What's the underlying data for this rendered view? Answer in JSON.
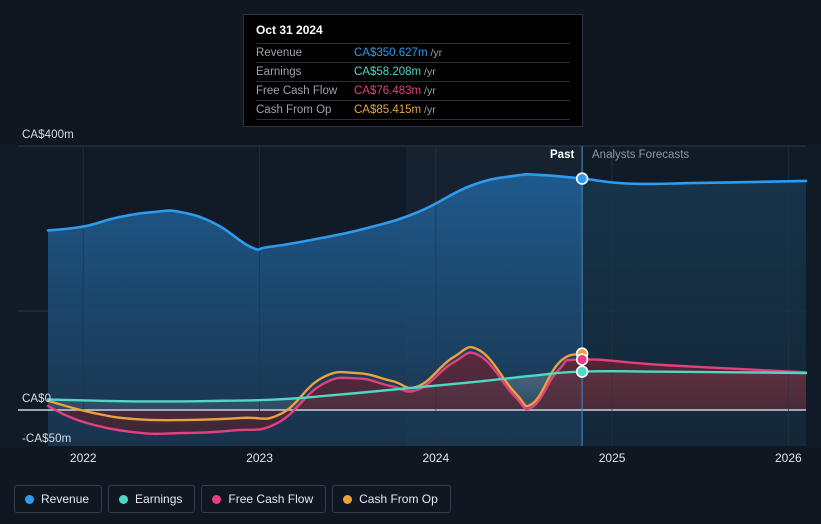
{
  "tooltip": {
    "title": "Oct 31 2024",
    "rows": [
      {
        "name": "Revenue",
        "value": "CA$350.627m",
        "unit": "/yr",
        "color": "#2e9bef"
      },
      {
        "name": "Earnings",
        "value": "CA$58.208m",
        "unit": "/yr",
        "color": "#4fd8c2"
      },
      {
        "name": "Free Cash Flow",
        "value": "CA$76.483m",
        "unit": "/yr",
        "color": "#e4407f"
      },
      {
        "name": "Cash From Op",
        "value": "CA$85.415m",
        "unit": "/yr",
        "color": "#e8a33d"
      }
    ]
  },
  "period": {
    "past_label": "Past",
    "forecast_label": "Analysts Forecasts"
  },
  "legend": [
    {
      "label": "Revenue",
      "color": "#2e9bef"
    },
    {
      "label": "Earnings",
      "color": "#4fd8c2"
    },
    {
      "label": "Free Cash Flow",
      "color": "#e4407f"
    },
    {
      "label": "Cash From Op",
      "color": "#e8a33d"
    }
  ],
  "chart_data": {
    "type": "area",
    "title": "",
    "xlabel": "",
    "ylabel": "",
    "currency": "CA$",
    "ylim": [
      -50,
      400
    ],
    "y_ticks": [
      {
        "label": "CA$400m",
        "value": 400
      },
      {
        "label": "CA$0",
        "value": 0
      },
      {
        "label": "-CA$50m",
        "value": -50
      }
    ],
    "x_ticks": [
      "2022",
      "2023",
      "2024",
      "2025",
      "2026"
    ],
    "xlim": [
      "2021.75",
      "2026.1"
    ],
    "grid": true,
    "legend_position": "bottom-left",
    "forecast_divider_x": "2024.83",
    "highlight_date": "Oct 31 2024",
    "series": [
      {
        "name": "Revenue",
        "color": "#2e9bef",
        "fill": "#1b4a74",
        "unit": "m",
        "points": [
          {
            "x": 2021.8,
            "y": 272
          },
          {
            "x": 2022.0,
            "y": 278
          },
          {
            "x": 2022.2,
            "y": 292
          },
          {
            "x": 2022.4,
            "y": 300
          },
          {
            "x": 2022.55,
            "y": 300
          },
          {
            "x": 2022.75,
            "y": 282
          },
          {
            "x": 2022.95,
            "y": 247
          },
          {
            "x": 2023.05,
            "y": 247
          },
          {
            "x": 2023.3,
            "y": 258
          },
          {
            "x": 2023.6,
            "y": 275
          },
          {
            "x": 2023.9,
            "y": 300
          },
          {
            "x": 2024.2,
            "y": 340
          },
          {
            "x": 2024.45,
            "y": 355
          },
          {
            "x": 2024.6,
            "y": 356
          },
          {
            "x": 2024.83,
            "y": 350.627
          },
          {
            "x": 2025.1,
            "y": 343
          },
          {
            "x": 2025.5,
            "y": 344
          },
          {
            "x": 2026.1,
            "y": 347
          }
        ]
      },
      {
        "name": "Earnings",
        "color": "#4fd8c2",
        "unit": "m",
        "points": [
          {
            "x": 2021.8,
            "y": 16
          },
          {
            "x": 2022.3,
            "y": 13
          },
          {
            "x": 2022.8,
            "y": 14
          },
          {
            "x": 2023.1,
            "y": 16
          },
          {
            "x": 2023.4,
            "y": 22
          },
          {
            "x": 2023.8,
            "y": 32
          },
          {
            "x": 2024.2,
            "y": 42
          },
          {
            "x": 2024.55,
            "y": 52
          },
          {
            "x": 2024.83,
            "y": 58.208
          },
          {
            "x": 2025.3,
            "y": 58
          },
          {
            "x": 2026.1,
            "y": 56
          }
        ]
      },
      {
        "name": "Free Cash Flow",
        "color": "#e4407f",
        "unit": "m",
        "points": [
          {
            "x": 2021.8,
            "y": 6
          },
          {
            "x": 2022.0,
            "y": -18
          },
          {
            "x": 2022.3,
            "y": -34
          },
          {
            "x": 2022.55,
            "y": -35
          },
          {
            "x": 2022.85,
            "y": -31
          },
          {
            "x": 2023.1,
            "y": -20
          },
          {
            "x": 2023.35,
            "y": 38
          },
          {
            "x": 2023.55,
            "y": 48
          },
          {
            "x": 2023.75,
            "y": 36
          },
          {
            "x": 2023.9,
            "y": 31
          },
          {
            "x": 2024.1,
            "y": 72
          },
          {
            "x": 2024.25,
            "y": 82
          },
          {
            "x": 2024.45,
            "y": 20
          },
          {
            "x": 2024.55,
            "y": 5
          },
          {
            "x": 2024.7,
            "y": 62
          },
          {
            "x": 2024.83,
            "y": 76.483
          },
          {
            "x": 2025.3,
            "y": 68
          },
          {
            "x": 2026.1,
            "y": 57
          }
        ]
      },
      {
        "name": "Cash From Op",
        "color": "#e8a33d",
        "unit": "m",
        "points": [
          {
            "x": 2021.8,
            "y": 14
          },
          {
            "x": 2022.05,
            "y": -4
          },
          {
            "x": 2022.3,
            "y": -14
          },
          {
            "x": 2022.6,
            "y": -15
          },
          {
            "x": 2022.9,
            "y": -12
          },
          {
            "x": 2023.12,
            "y": -6
          },
          {
            "x": 2023.35,
            "y": 48
          },
          {
            "x": 2023.55,
            "y": 56
          },
          {
            "x": 2023.75,
            "y": 44
          },
          {
            "x": 2023.9,
            "y": 36
          },
          {
            "x": 2024.1,
            "y": 80
          },
          {
            "x": 2024.25,
            "y": 90
          },
          {
            "x": 2024.45,
            "y": 26
          },
          {
            "x": 2024.55,
            "y": 10
          },
          {
            "x": 2024.7,
            "y": 72
          },
          {
            "x": 2024.83,
            "y": 85.415
          }
        ]
      }
    ],
    "markers": [
      {
        "series": "Revenue",
        "x": 2024.83,
        "y": 350.627,
        "color": "#2e9bef"
      },
      {
        "series": "Cash From Op",
        "x": 2024.83,
        "y": 85.415,
        "color": "#e8a33d"
      },
      {
        "series": "Free Cash Flow",
        "x": 2024.83,
        "y": 76.483,
        "color": "#e4407f"
      },
      {
        "series": "Earnings",
        "x": 2024.83,
        "y": 58.208,
        "color": "#4fd8c2"
      }
    ]
  }
}
